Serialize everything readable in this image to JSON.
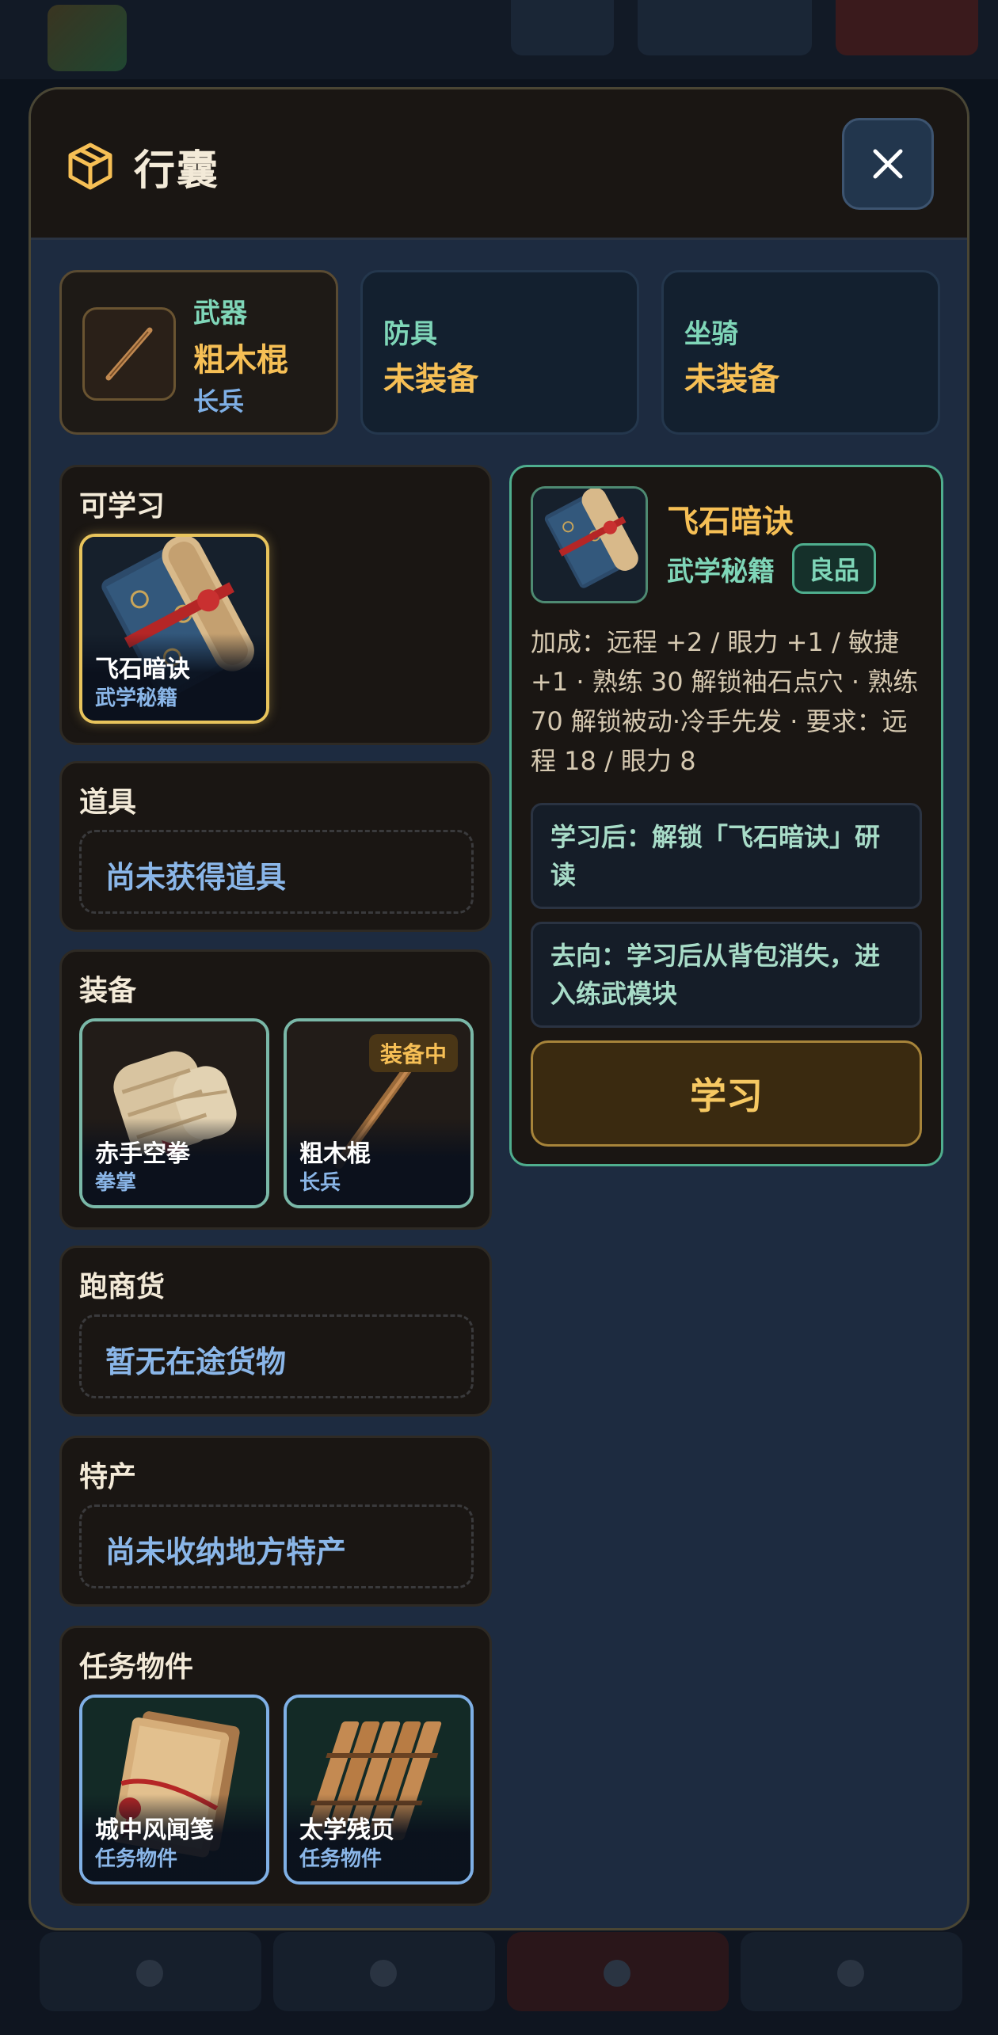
{
  "modal": {
    "title": "行囊"
  },
  "slots": [
    {
      "label": "武器",
      "value": "粗木棍",
      "sub": "长兵"
    },
    {
      "label": "防具",
      "value": "未装备"
    },
    {
      "label": "坐骑",
      "value": "未装备"
    }
  ],
  "sections": {
    "learnable": {
      "title": "可学习",
      "items": [
        {
          "name": "飞石暗诀",
          "type": "武学秘籍"
        }
      ]
    },
    "props": {
      "title": "道具",
      "empty": "尚未获得道具"
    },
    "equipment": {
      "title": "装备",
      "items": [
        {
          "name": "赤手空拳",
          "type": "拳掌"
        },
        {
          "name": "粗木棍",
          "type": "长兵",
          "badge": "装备中"
        }
      ]
    },
    "goods": {
      "title": "跑商货",
      "empty": "暂无在途货物"
    },
    "specialty": {
      "title": "特产",
      "empty": "尚未收纳地方特产"
    },
    "quest": {
      "title": "任务物件",
      "items": [
        {
          "name": "城中风闻笺",
          "type": "任务物件"
        },
        {
          "name": "太学残页",
          "type": "任务物件"
        }
      ]
    }
  },
  "detail": {
    "name": "飞石暗诀",
    "type": "武学秘籍",
    "rarity": "良品",
    "description": "加成：远程 +2 / 眼力 +1 / 敏捷 +1 · 熟练 30 解锁袖石点穴 · 熟练 70 解锁被动·冷手先发 · 要求：远程 18 / 眼力 8",
    "after_learn": "学习后：解锁「飞石暗诀」研读",
    "destination": "去向：学习后从背包消失，进入练武模块",
    "action_label": "学习"
  },
  "colors": {
    "accent_gold": "#f6bf55",
    "accent_teal": "#7fd6b8",
    "accent_blue": "#8ab6e8",
    "panel_bg": "#1a1613",
    "modal_bg": "#1d2b40"
  }
}
